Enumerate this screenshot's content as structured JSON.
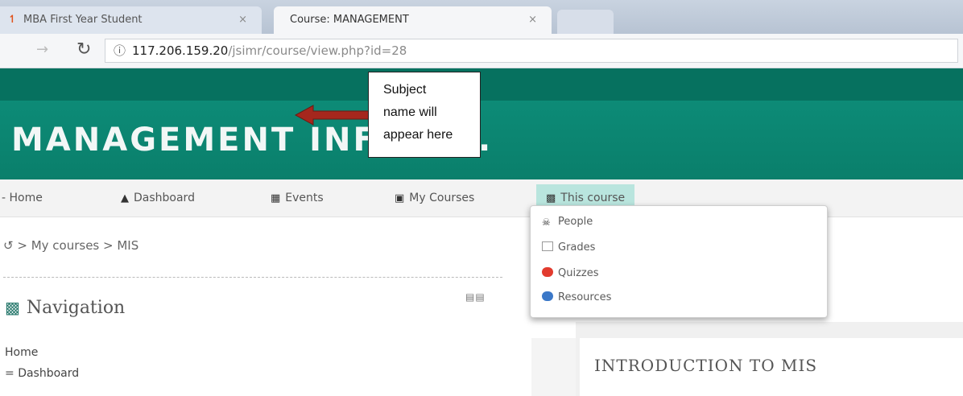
{
  "browser": {
    "tabs": [
      {
        "label": "MBA First Year Student",
        "close": "×"
      },
      {
        "label": "Course: MANAGEMENT",
        "close": "×"
      }
    ],
    "url": {
      "host": "117.206.159.20",
      "path": "/jsimr/course/view.php?id=28"
    }
  },
  "header": {
    "course_title": "MANAGEMENT INFO I ..."
  },
  "nav": {
    "items": [
      {
        "label": "Home"
      },
      {
        "label": "Dashboard",
        "icon": "dashboard-icon"
      },
      {
        "label": "Events",
        "icon": "calendar-icon"
      },
      {
        "label": "My Courses",
        "icon": "briefcase-icon"
      },
      {
        "label": "This course",
        "icon": "sitemap-icon"
      }
    ]
  },
  "dropdown": {
    "items": [
      {
        "label": "People",
        "icon": "people-icon"
      },
      {
        "label": "Grades",
        "icon": "grades-icon"
      },
      {
        "label": "Quizzes",
        "icon": "quizzes-icon"
      },
      {
        "label": "Resources",
        "icon": "resources-icon"
      }
    ]
  },
  "breadcrumb": {
    "text": "> My courses > MIS"
  },
  "navigation_block": {
    "title": "Navigation",
    "items": [
      "Home",
      "Dashboard"
    ]
  },
  "main": {
    "section_title": "INTRODUCTION TO MIS"
  },
  "annotation": {
    "lines": [
      "Subject",
      "name will",
      "appear here"
    ]
  },
  "colors": {
    "header": "#0a7f6b",
    "topstrip": "#06715f",
    "active_nav": "#b9e5de",
    "arrow": "#a5271d"
  }
}
